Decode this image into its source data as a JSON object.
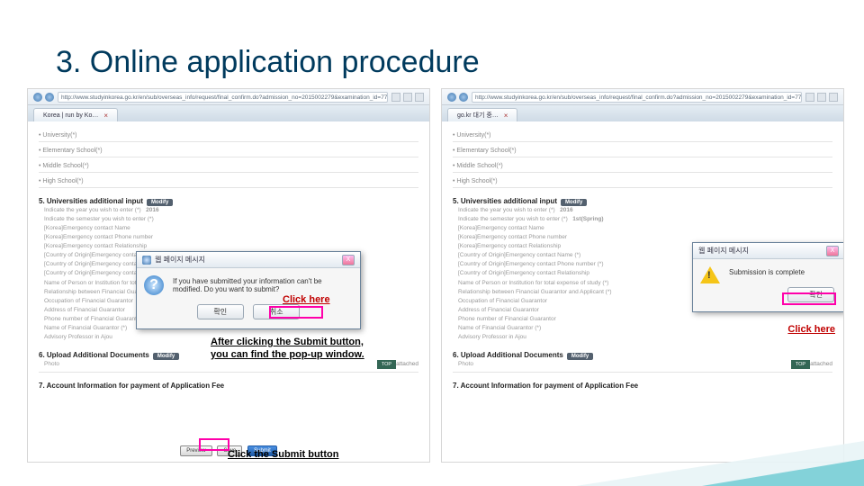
{
  "slide": {
    "title": "3. Online application procedure"
  },
  "browser": {
    "url": "http://www.studyinkorea.go.kr/en/sub/overseas_info/request/final_confirm.do?admission_no=2015002279&examination_id=779",
    "tab_left": "Korea | run by Ko…",
    "tab_right": "go.kr 대기 중…",
    "tab_close": "×"
  },
  "form": {
    "field_university": "• University(*)",
    "field_elem": "• Elementary School(*)",
    "field_middle": "• Middle School(*)",
    "field_high": "• High School(*)",
    "section5": "5. Universities additional input",
    "modify": "Modify",
    "year_label": "Indicate the year you wish to enter (*)",
    "year_value": "2016",
    "semester_label": "Indicate the semester you wish to enter (*)",
    "semester_value": "1st(Spring)",
    "lines": [
      "[Korea]Emergency contact Name",
      "[Korea]Emergency contact Phone number",
      "[Korea]Emergency contact Relationship",
      "[Country of Origin]Emergency contact Name (*)",
      "[Country of Origin]Emergency contact Phone number (*)",
      "[Country of Origin]Emergency contact Relationship",
      "Name of Person or Institution for total expense of study (*)",
      "Relationship between Financial Guarantor and Applicant (*)",
      "Occupation of Financial Guarantor",
      "Address of Financial Guarantor",
      "Phone number of Financial Guarantor",
      "Name of Financial Guarantor (*)",
      "Advisory Professor in Ajou"
    ],
    "section6": "6. Upload Additional Documents",
    "photo_label": "Photo",
    "photo_value": "attached",
    "section7": "7. Account Information for payment of Application Fee",
    "top": "TOP",
    "btn_preview": "Preview",
    "btn_save": "Save",
    "btn_submit": "Submit"
  },
  "dialog_confirm": {
    "title": "웹 페이지 메시지",
    "text": "If you have submitted your information can't be modified. Do you want to submit?",
    "ok": "확인",
    "cancel": "취소",
    "close": "X"
  },
  "dialog_done": {
    "title": "웹 페이지 메시지",
    "text": "Submission is complete",
    "ok": "확인",
    "close": "X"
  },
  "annotations": {
    "click_here_left": "Click here",
    "after_text": "After clicking the Submit button, you can find the pop-up window.",
    "click_submit": "Click the Submit button",
    "click_here_right": "Click here"
  }
}
